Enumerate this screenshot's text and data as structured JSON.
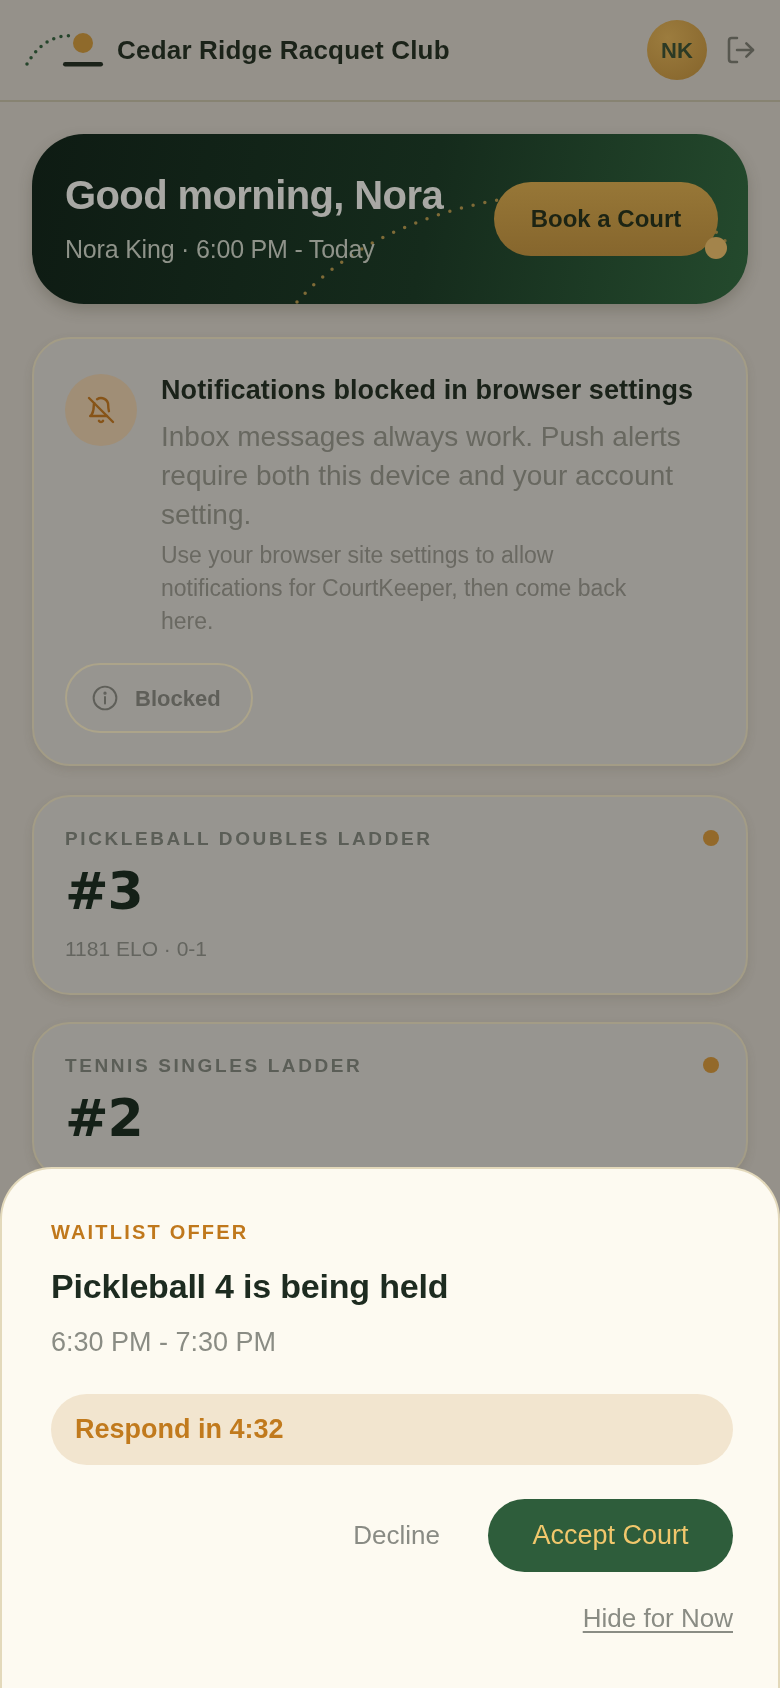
{
  "header": {
    "title": "Cedar Ridge Racquet Club",
    "avatar_initials": "NK"
  },
  "hero": {
    "greeting": "Good morning, Nora",
    "subtitle": "Nora King · 6:00 PM - Today",
    "button": "Book a Court"
  },
  "notification": {
    "title": "Notifications blocked in browser settings",
    "body": "Inbox messages always work. Push alerts require both this device and your account setting.",
    "hint": "Use your browser site settings to allow notifications for CourtKeeper, then come back here.",
    "status": "Blocked"
  },
  "ladders": [
    {
      "label": "PICKLEBALL DOUBLES LADDER",
      "rank": "#3",
      "stats": "1181 ELO · 0-1"
    },
    {
      "label": "TENNIS SINGLES LADDER",
      "rank": "#2"
    }
  ],
  "offer_sheet": {
    "eyebrow": "WAITLIST OFFER",
    "title": "Pickleball 4 is being held",
    "time": "6:30 PM - 7:30 PM",
    "countdown": "Respond in 4:32",
    "actions": [
      {
        "label": "Decline",
        "kind": "text"
      },
      {
        "label": "Accept Court",
        "kind": "primary"
      }
    ],
    "link": "Hide for Now"
  }
}
